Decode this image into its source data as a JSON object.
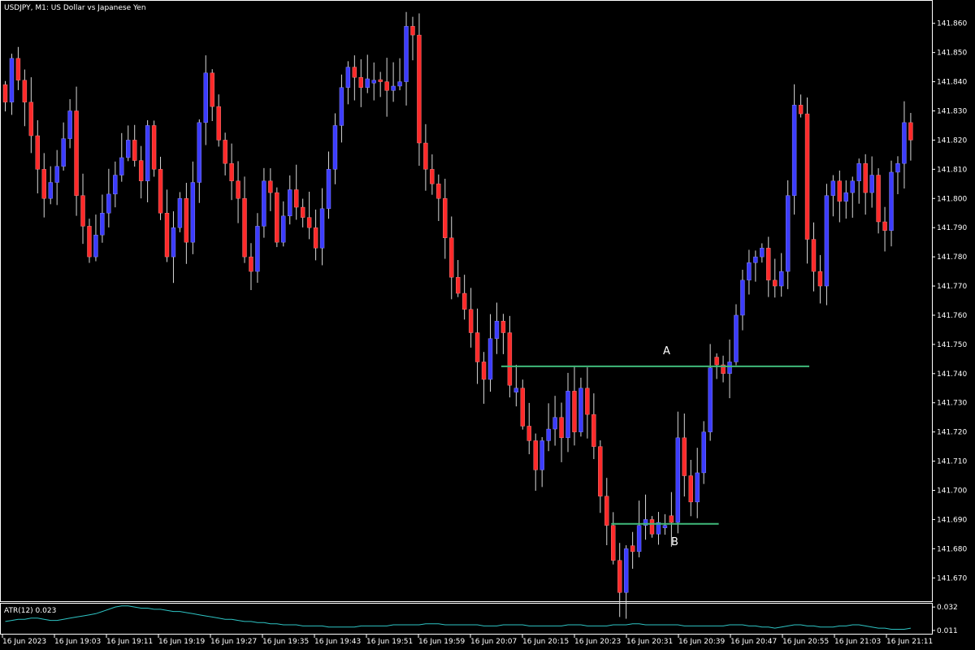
{
  "colors": {
    "background": "#000000",
    "frame": "#ffffff",
    "bull": "#3c3cff",
    "bear": "#ff2a2a",
    "wick": "#d8d8d8",
    "level_line": "#3fb97a",
    "atr_line": "#2ec4c4"
  },
  "chart_data": [
    {
      "type": "candlestick",
      "title": "USDJPY, M1:  US Dollar vs Japanese Yen",
      "ylim": [
        141.662,
        141.868
      ],
      "y_ticks": [
        "141.860",
        "141.850",
        "141.840",
        "141.830",
        "141.820",
        "141.810",
        "141.800",
        "141.790",
        "141.780",
        "141.770",
        "141.760",
        "141.750",
        "141.740",
        "141.730",
        "141.720",
        "141.710",
        "141.700",
        "141.690",
        "141.680",
        "141.670"
      ],
      "x_ticks": [
        "16 Jun 2023",
        "16 Jun 19:03",
        "16 Jun 19:11",
        "16 Jun 19:19",
        "16 Jun 19:27",
        "16 Jun 19:35",
        "16 Jun 19:43",
        "16 Jun 19:51",
        "16 Jun 19:59",
        "16 Jun 20:07",
        "16 Jun 20:15",
        "16 Jun 20:23",
        "16 Jun 20:31",
        "16 Jun 20:39",
        "16 Jun 20:47",
        "16 Jun 20:55",
        "16 Jun 21:03",
        "16 Jun 21:11"
      ],
      "candle_count": 141,
      "close_anchors": [
        [
          0,
          141.833
        ],
        [
          1,
          141.848
        ],
        [
          3,
          141.833
        ],
        [
          5,
          141.81
        ],
        [
          6,
          141.8
        ],
        [
          8,
          141.811
        ],
        [
          10,
          141.83
        ],
        [
          11,
          141.801
        ],
        [
          13,
          141.78
        ],
        [
          15,
          141.795
        ],
        [
          17,
          141.808
        ],
        [
          19,
          141.82
        ],
        [
          21,
          141.806
        ],
        [
          22,
          141.825
        ],
        [
          24,
          141.795
        ],
        [
          25,
          141.78
        ],
        [
          27,
          141.8
        ],
        [
          28,
          141.785
        ],
        [
          30,
          141.826
        ],
        [
          31,
          141.843
        ],
        [
          33,
          141.82
        ],
        [
          34,
          141.812
        ],
        [
          36,
          141.8
        ],
        [
          37,
          141.78
        ],
        [
          38,
          141.775
        ],
        [
          40,
          141.806
        ],
        [
          41,
          141.802
        ],
        [
          42,
          141.785
        ],
        [
          44,
          141.803
        ],
        [
          45,
          141.797
        ],
        [
          47,
          141.79
        ],
        [
          48,
          141.783
        ],
        [
          50,
          141.81
        ],
        [
          51,
          141.825
        ],
        [
          52,
          141.838
        ],
        [
          53,
          141.845
        ],
        [
          55,
          141.838
        ],
        [
          56,
          141.841
        ],
        [
          58,
          141.84
        ],
        [
          59,
          141.837
        ],
        [
          61,
          141.84
        ],
        [
          62,
          141.859
        ],
        [
          63,
          141.856
        ],
        [
          64,
          141.819
        ],
        [
          65,
          141.81
        ],
        [
          67,
          141.8
        ],
        [
          69,
          141.773
        ],
        [
          71,
          141.762
        ],
        [
          72,
          141.754
        ],
        [
          73,
          141.744
        ],
        [
          74,
          141.738
        ],
        [
          75,
          141.752
        ],
        [
          76,
          141.758
        ],
        [
          77,
          141.754
        ],
        [
          78,
          141.736
        ],
        [
          79,
          141.735
        ],
        [
          80,
          141.722
        ],
        [
          81,
          141.717
        ],
        [
          82,
          141.707
        ],
        [
          83,
          141.717
        ],
        [
          84,
          141.721
        ],
        [
          85,
          141.725
        ],
        [
          86,
          141.718
        ],
        [
          87,
          141.734
        ],
        [
          88,
          141.72
        ],
        [
          89,
          141.735
        ],
        [
          90,
          141.726
        ],
        [
          91,
          141.715
        ],
        [
          92,
          141.698
        ],
        [
          93,
          141.688
        ],
        [
          94,
          141.676
        ],
        [
          95,
          141.665
        ],
        [
          96,
          141.68
        ],
        [
          97,
          141.679
        ],
        [
          98,
          141.688
        ],
        [
          99,
          141.69
        ],
        [
          100,
          141.685
        ],
        [
          101,
          141.689
        ],
        [
          102,
          141.688
        ],
        [
          103,
          141.689
        ],
        [
          104,
          141.718
        ],
        [
          105,
          141.705
        ],
        [
          106,
          141.696
        ],
        [
          107,
          141.706
        ],
        [
          108,
          141.72
        ],
        [
          109,
          141.742
        ],
        [
          110,
          141.743
        ],
        [
          111,
          141.74
        ],
        [
          112,
          141.744
        ],
        [
          113,
          141.76
        ],
        [
          114,
          141.772
        ],
        [
          115,
          141.778
        ],
        [
          116,
          141.78
        ],
        [
          117,
          141.783
        ],
        [
          118,
          141.772
        ],
        [
          119,
          141.77
        ],
        [
          120,
          141.775
        ],
        [
          121,
          141.801
        ],
        [
          122,
          141.832
        ],
        [
          123,
          141.829
        ],
        [
          124,
          141.786
        ],
        [
          125,
          141.775
        ],
        [
          126,
          141.77
        ],
        [
          127,
          141.801
        ],
        [
          128,
          141.806
        ],
        [
          129,
          141.799
        ],
        [
          130,
          141.802
        ],
        [
          131,
          141.806
        ],
        [
          132,
          141.812
        ],
        [
          133,
          141.802
        ],
        [
          134,
          141.808
        ],
        [
          135,
          141.792
        ],
        [
          136,
          141.789
        ],
        [
          137,
          141.809
        ],
        [
          138,
          141.812
        ],
        [
          139,
          141.826
        ],
        [
          140,
          141.82
        ]
      ],
      "annotations": [
        {
          "label": "A",
          "level": 141.7425,
          "from_index": 77,
          "to_index": 124
        },
        {
          "label": "B",
          "level": 141.6885,
          "from_index": 94,
          "to_index": 110
        }
      ]
    },
    {
      "type": "line",
      "title": "ATR(12) 0.023",
      "ylim": [
        0.008,
        0.035
      ],
      "y_ticks": [
        "0.032",
        "0.011"
      ],
      "series": [
        {
          "name": "ATR(12)",
          "values": [
            0.019,
            0.02,
            0.021,
            0.021,
            0.022,
            0.022,
            0.021,
            0.02,
            0.02,
            0.021,
            0.022,
            0.023,
            0.024,
            0.025,
            0.026,
            0.028,
            0.03,
            0.032,
            0.033,
            0.033,
            0.032,
            0.031,
            0.031,
            0.03,
            0.03,
            0.029,
            0.028,
            0.028,
            0.027,
            0.026,
            0.025,
            0.024,
            0.023,
            0.022,
            0.021,
            0.021,
            0.02,
            0.019,
            0.019,
            0.018,
            0.018,
            0.017,
            0.017,
            0.016,
            0.016,
            0.016,
            0.015,
            0.015,
            0.015,
            0.015,
            0.014,
            0.014,
            0.014,
            0.014,
            0.014,
            0.015,
            0.015,
            0.015,
            0.015,
            0.015,
            0.016,
            0.016,
            0.016,
            0.016,
            0.016,
            0.017,
            0.017,
            0.017,
            0.016,
            0.016,
            0.016,
            0.016,
            0.016,
            0.016,
            0.015,
            0.015,
            0.015,
            0.016,
            0.016,
            0.016,
            0.016,
            0.015,
            0.015,
            0.015,
            0.015,
            0.015,
            0.015,
            0.016,
            0.016,
            0.016,
            0.015,
            0.015,
            0.015,
            0.015,
            0.016,
            0.016,
            0.016,
            0.017,
            0.017,
            0.016,
            0.016,
            0.016,
            0.016,
            0.016,
            0.016,
            0.015,
            0.015,
            0.015,
            0.015,
            0.015,
            0.015,
            0.015,
            0.016,
            0.016,
            0.016,
            0.015,
            0.015,
            0.014,
            0.014,
            0.013,
            0.014,
            0.015,
            0.016,
            0.016,
            0.015,
            0.015,
            0.014,
            0.014,
            0.014,
            0.015,
            0.015,
            0.016,
            0.016,
            0.015,
            0.014,
            0.013,
            0.013,
            0.012,
            0.012,
            0.012,
            0.013
          ]
        }
      ]
    }
  ]
}
